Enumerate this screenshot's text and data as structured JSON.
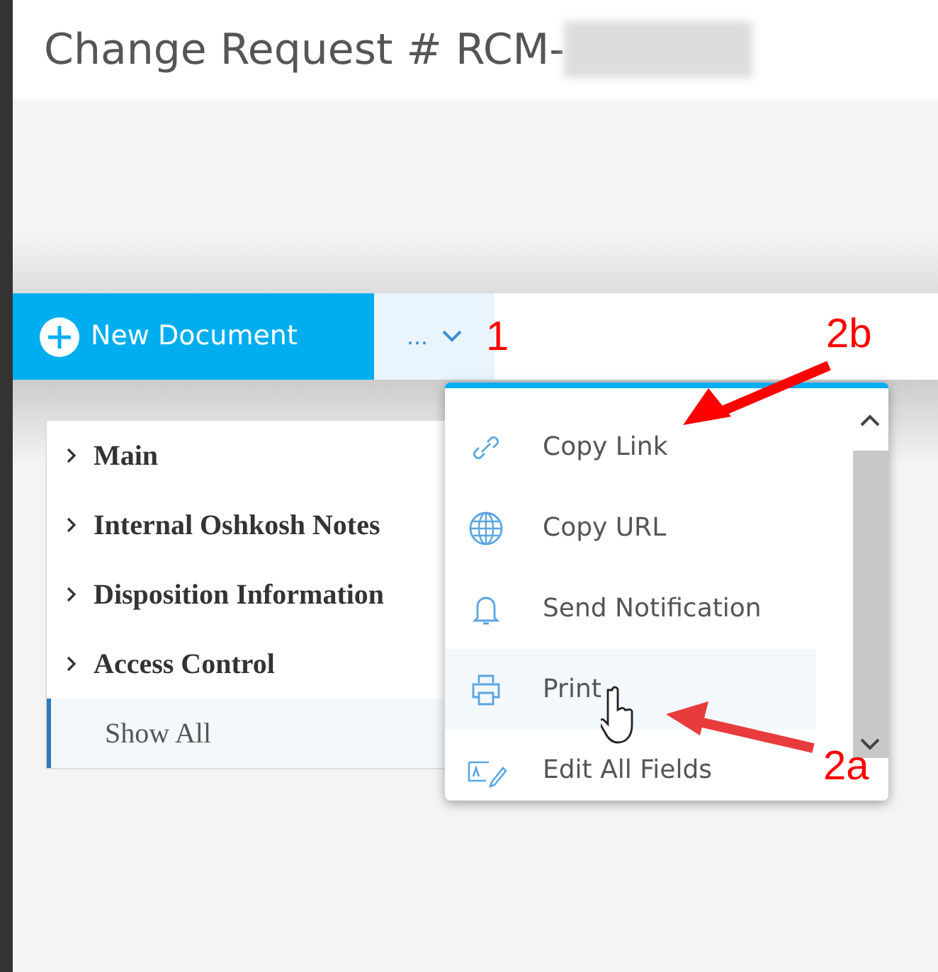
{
  "title": "Change Request # RCM-",
  "toolbar": {
    "new_button": "New Document",
    "more_button": {
      "label": "...",
      "expanded": true
    }
  },
  "sidebar": {
    "items": [
      {
        "label": "Main",
        "kind": "section",
        "selected": false
      },
      {
        "label": "Internal Oshkosh Notes",
        "kind": "section",
        "selected": false
      },
      {
        "label": "Disposition Information",
        "kind": "section",
        "selected": false
      },
      {
        "label": "Access Control",
        "kind": "section",
        "selected": false
      },
      {
        "label": "Show All",
        "kind": "link",
        "selected": true
      }
    ]
  },
  "menu": {
    "items": [
      {
        "label": "Copy Link",
        "kind": "link",
        "hovered": false
      },
      {
        "label": "Copy URL",
        "kind": "globe",
        "hovered": false
      },
      {
        "label": "Send Notification",
        "kind": "bell",
        "hovered": false
      },
      {
        "label": "Print",
        "kind": "printer",
        "hovered": true
      },
      {
        "label": "Edit All Fields",
        "kind": "edit",
        "hovered": false
      }
    ]
  },
  "annotations": [
    {
      "label": "1",
      "kind": "label"
    },
    {
      "label": "2b",
      "kind": "arrow"
    },
    {
      "label": "2a",
      "kind": "arrow"
    }
  ]
}
